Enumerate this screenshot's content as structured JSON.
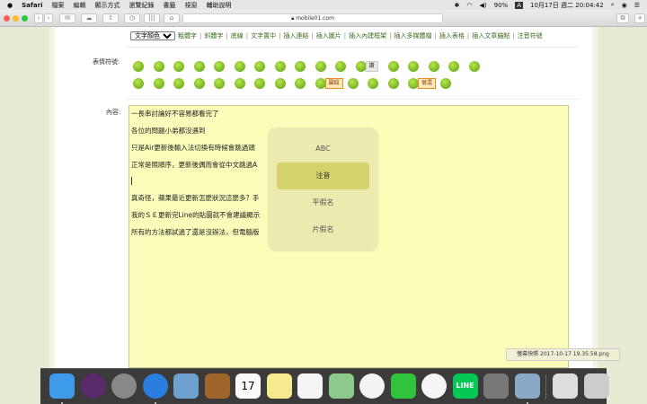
{
  "menubar": {
    "items": [
      "Safari",
      "檔案",
      "編輯",
      "顯示方式",
      "瀏覽紀錄",
      "書籤",
      "視窗",
      "輔助說明"
    ],
    "battery": "90%",
    "input_badge": "A",
    "datetime": "10月17日 週二 20:04:42"
  },
  "browser": {
    "url": "mobile01.com"
  },
  "format_bar": {
    "color_select": "文字顏色",
    "links": [
      "粗體字",
      "斜體字",
      "底線",
      "文字置中",
      "插入連結",
      "插入圖片",
      "插入內建框架",
      "插入多媒體檔",
      "插入表格",
      "插入文章錨點",
      "注音符號"
    ]
  },
  "emoticons": {
    "label": "表情符號:",
    "row1": [
      "",
      "",
      "",
      "",
      "",
      "",
      "",
      "",
      "",
      "",
      "",
      "讚",
      "",
      "",
      "",
      "",
      ""
    ],
    "row2": [
      "",
      "",
      "",
      "",
      "",
      "",
      "",
      "",
      "",
      "圍毆",
      "",
      "",
      "",
      "很混",
      ""
    ]
  },
  "content": {
    "label": "內容:",
    "lines": [
      "一長串討論好不容易都看完了",
      "各位的問題小弟都沒遇到",
      "只是Air更新後輸入法切換有時候會跳過頭",
      "正常是照順序，更新後偶而會從中文跳過A",
      "",
      "真奇怪，蘋果最近更新怎麼狀況這麼多？手",
      "我的ＳＥ更新完Line的貼圖就不會建議顯示",
      "所有的方法都試過了還是沒辦法，但電腦版"
    ]
  },
  "ime_popup": {
    "options": [
      "ABC",
      "注音",
      "平假名",
      "片假名"
    ],
    "selected": "注音"
  },
  "dock": {
    "tooltip": "螢幕快照 2017-10-17 19.35.58.png",
    "apps": [
      "finder",
      "siri",
      "launchpad",
      "safari",
      "mail",
      "contacts",
      "calendar",
      "notes",
      "reminders",
      "maps",
      "photos",
      "facetime",
      "itunes",
      "line",
      "system-preferences",
      "preview",
      "screenshot",
      "trash"
    ],
    "calendar_day": "17",
    "line_label": "LINE"
  }
}
